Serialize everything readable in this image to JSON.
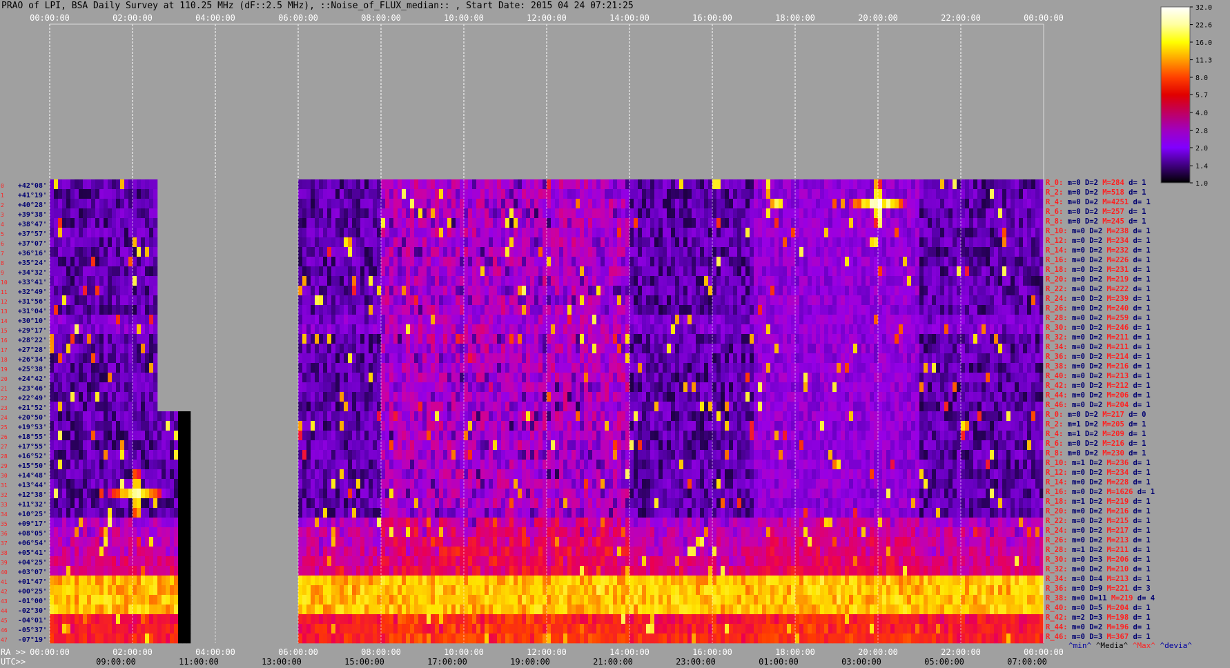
{
  "title": "PRAO of LPI, BSA Daily Survey at 110.25 MHz (dF::2.5 MHz), ::Noise_of_FLUX_median:: , Start Date: 2015 04 24 07:21:25",
  "chart_data": {
    "type": "heatmap",
    "top_axis_ticks": [
      "00:00:00",
      "02:00:00",
      "04:00:00",
      "06:00:00",
      "08:00:00",
      "10:00:00",
      "12:00:00",
      "14:00:00",
      "16:00:00",
      "18:00:00",
      "20:00:00",
      "22:00:00",
      "00:00:00"
    ],
    "bottom_ra_label": "RA >>",
    "bottom_ra_ticks": [
      "00:00:00",
      "02:00:00",
      "04:00:00",
      "06:00:00",
      "08:00:00",
      "10:00:00",
      "12:00:00",
      "14:00:00",
      "16:00:00",
      "18:00:00",
      "20:00:00",
      "22:00:00",
      "00:00:00"
    ],
    "bottom_utc_label": "UTC>>",
    "bottom_utc_ticks": [
      "09:00:00",
      "11:00:00",
      "13:00:00",
      "15:00:00",
      "17:00:00",
      "19:00:00",
      "21:00:00",
      "23:00:00",
      "01:00:00",
      "03:00:00",
      "05:00:00",
      "07:00:00"
    ],
    "declinations": [
      "+42°08'",
      "+41°19'",
      "+40°28'",
      "+39°38'",
      "+38°47'",
      "+37°57'",
      "+37°07'",
      "+36°16'",
      "+35°24'",
      "+34°32'",
      "+33°41'",
      "+32°49'",
      "+31°56'",
      "+31°04'",
      "+30°10'",
      "+29°17'",
      "+28°22'",
      "+27°28'",
      "+26°34'",
      "+25°38'",
      "+24°42'",
      "+23°46'",
      "+22°49'",
      "+21°52'",
      "+20°50'",
      "+19°53'",
      "+18°55'",
      "+17°55'",
      "+16°52'",
      "+15°50'",
      "+14°48'",
      "+13°44'",
      "+12°38'",
      "+11°32'",
      "+10°25'",
      "+09°17'",
      "+08°05'",
      "+06°54'",
      "+05°41'",
      "+04°25'",
      "+03°07'",
      "+01°47'",
      "+00°25'",
      "-01°00'",
      "-02°30'",
      "-04°01'",
      "-05°37'",
      "-07°19'"
    ],
    "colorbar_ticks": [
      "32.0",
      "22.6",
      "16.0",
      "11.3",
      "8.0",
      "5.7",
      "4.0",
      "2.8",
      "2.0",
      "1.4",
      "1.0"
    ],
    "colorbar_colors": [
      "#ffffff",
      "#ffffa0",
      "#ffff00",
      "#ffa000",
      "#ff4000",
      "#e00000",
      "#c00060",
      "#a000c0",
      "#8000ff",
      "#400080",
      "#000000"
    ],
    "colorbar_scale": "log",
    "colorbar_range": [
      1.0,
      32.0
    ],
    "background_color": "#a0a0a0",
    "ra_range_hours": [
      0,
      24
    ],
    "data_gaps_ra_hours": [
      {
        "from": 2.6,
        "to": 6.0,
        "dec_from": "+42°08'",
        "dec_to": "+21°52'"
      },
      {
        "from": 3.1,
        "to": 6.0,
        "dec_from": "+20°50'",
        "dec_to": "-07°19'"
      }
    ],
    "features": [
      {
        "kind": "point_source",
        "ra_hours": 20.0,
        "dec": "+40°28'",
        "brightness": 32.0
      },
      {
        "kind": "point_source",
        "ra_hours": 2.1,
        "dec": "+12°38'",
        "brightness": 22.6
      },
      {
        "kind": "bright_band",
        "dec_from": "+01°47'",
        "dec_to": "-02°30'",
        "brightness": 16.0
      },
      {
        "kind": "bright_band",
        "dec_from": "+30°10'",
        "dec_to": "+29°17'",
        "brightness": 2.8
      }
    ]
  },
  "stats": {
    "rows": [
      {
        "label": "R_0:",
        "m": "m=0",
        "D": "D=2",
        "M": "M=284",
        "d": "d= 1"
      },
      {
        "label": "R_2:",
        "m": "m=0",
        "D": "D=2",
        "M": "M=518",
        "d": "d= 1"
      },
      {
        "label": "R_4:",
        "m": "m=0",
        "D": "D=2",
        "M": "M=4251",
        "d": "d= 1"
      },
      {
        "label": "R_6:",
        "m": "m=0",
        "D": "D=2",
        "M": "M=257",
        "d": "d= 1"
      },
      {
        "label": "R_8:",
        "m": "m=0",
        "D": "D=2",
        "M": "M=245",
        "d": "d= 1"
      },
      {
        "label": "R_10:",
        "m": "m=0",
        "D": "D=2",
        "M": "M=238",
        "d": "d= 1"
      },
      {
        "label": "R_12:",
        "m": "m=0",
        "D": "D=2",
        "M": "M=234",
        "d": "d= 1"
      },
      {
        "label": "R_14:",
        "m": "m=0",
        "D": "D=2",
        "M": "M=232",
        "d": "d= 1"
      },
      {
        "label": "R_16:",
        "m": "m=0",
        "D": "D=2",
        "M": "M=226",
        "d": "d= 1"
      },
      {
        "label": "R_18:",
        "m": "m=0",
        "D": "D=2",
        "M": "M=231",
        "d": "d= 1"
      },
      {
        "label": "R_20:",
        "m": "m=0",
        "D": "D=2",
        "M": "M=219",
        "d": "d= 1"
      },
      {
        "label": "R_22:",
        "m": "m=0",
        "D": "D=2",
        "M": "M=222",
        "d": "d= 1"
      },
      {
        "label": "R_24:",
        "m": "m=0",
        "D": "D=2",
        "M": "M=239",
        "d": "d= 1"
      },
      {
        "label": "R_26:",
        "m": "m=0",
        "D": "D=2",
        "M": "M=240",
        "d": "d= 1"
      },
      {
        "label": "R_28:",
        "m": "m=0",
        "D": "D=2",
        "M": "M=259",
        "d": "d= 1"
      },
      {
        "label": "R_30:",
        "m": "m=0",
        "D": "D=2",
        "M": "M=246",
        "d": "d= 1"
      },
      {
        "label": "R_32:",
        "m": "m=0",
        "D": "D=2",
        "M": "M=211",
        "d": "d= 1"
      },
      {
        "label": "R_34:",
        "m": "m=0",
        "D": "D=2",
        "M": "M=211",
        "d": "d= 1"
      },
      {
        "label": "R_36:",
        "m": "m=0",
        "D": "D=2",
        "M": "M=214",
        "d": "d= 1"
      },
      {
        "label": "R_38:",
        "m": "m=0",
        "D": "D=2",
        "M": "M=216",
        "d": "d= 1"
      },
      {
        "label": "R_40:",
        "m": "m=0",
        "D": "D=2",
        "M": "M=213",
        "d": "d= 1"
      },
      {
        "label": "R_42:",
        "m": "m=0",
        "D": "D=2",
        "M": "M=212",
        "d": "d= 1"
      },
      {
        "label": "R_44:",
        "m": "m=0",
        "D": "D=2",
        "M": "M=206",
        "d": "d= 1"
      },
      {
        "label": "R_46:",
        "m": "m=0",
        "D": "D=2",
        "M": "M=204",
        "d": "d= 1"
      },
      {
        "label": "R_0:",
        "m": "m=0",
        "D": "D=2",
        "M": "M=217",
        "d": "d= 0"
      },
      {
        "label": "R_2:",
        "m": "m=1",
        "D": "D=2",
        "M": "M=205",
        "d": "d= 1"
      },
      {
        "label": "R_4:",
        "m": "m=1",
        "D": "D=2",
        "M": "M=209",
        "d": "d= 1"
      },
      {
        "label": "R_6:",
        "m": "m=0",
        "D": "D=2",
        "M": "M=216",
        "d": "d= 1"
      },
      {
        "label": "R_8:",
        "m": "m=0",
        "D": "D=2",
        "M": "M=230",
        "d": "d= 1"
      },
      {
        "label": "R_10:",
        "m": "m=1",
        "D": "D=2",
        "M": "M=236",
        "d": "d= 1"
      },
      {
        "label": "R_12:",
        "m": "m=0",
        "D": "D=2",
        "M": "M=234",
        "d": "d= 1"
      },
      {
        "label": "R_14:",
        "m": "m=0",
        "D": "D=2",
        "M": "M=228",
        "d": "d= 1"
      },
      {
        "label": "R_16:",
        "m": "m=0",
        "D": "D=2",
        "M": "M=1626",
        "d": "d= 1"
      },
      {
        "label": "R_18:",
        "m": "m=1",
        "D": "D=2",
        "M": "M=219",
        "d": "d= 1"
      },
      {
        "label": "R_20:",
        "m": "m=0",
        "D": "D=2",
        "M": "M=216",
        "d": "d= 1"
      },
      {
        "label": "R_22:",
        "m": "m=0",
        "D": "D=2",
        "M": "M=215",
        "d": "d= 1"
      },
      {
        "label": "R_24:",
        "m": "m=0",
        "D": "D=2",
        "M": "M=217",
        "d": "d= 1"
      },
      {
        "label": "R_26:",
        "m": "m=0",
        "D": "D=2",
        "M": "M=213",
        "d": "d= 1"
      },
      {
        "label": "R_28:",
        "m": "m=1",
        "D": "D=2",
        "M": "M=211",
        "d": "d= 1"
      },
      {
        "label": "R_30:",
        "m": "m=0",
        "D": "D=3",
        "M": "M=206",
        "d": "d= 1"
      },
      {
        "label": "R_32:",
        "m": "m=0",
        "D": "D=2",
        "M": "M=210",
        "d": "d= 1"
      },
      {
        "label": "R_34:",
        "m": "m=0",
        "D": "D=4",
        "M": "M=213",
        "d": "d= 1"
      },
      {
        "label": "R_36:",
        "m": "m=0",
        "D": "D=9",
        "M": "M=221",
        "d": "d= 3"
      },
      {
        "label": "R_38:",
        "m": "m=0",
        "D": "D=11",
        "M": "M=219",
        "d": "d= 4"
      },
      {
        "label": "R_40:",
        "m": "m=0",
        "D": "D=5",
        "M": "M=204",
        "d": "d= 1"
      },
      {
        "label": "R_42:",
        "m": "m=2",
        "D": "D=3",
        "M": "M=198",
        "d": "d= 1"
      },
      {
        "label": "R_44:",
        "m": "m=0",
        "D": "D=2",
        "M": "M=196",
        "d": "d= 1"
      },
      {
        "label": "R_46:",
        "m": "m=0",
        "D": "D=3",
        "M": "M=367",
        "d": "d= 1"
      }
    ],
    "footer": {
      "min": "^min^",
      "median": "^Media^",
      "max": "^Max^",
      "dev": "^devia^"
    }
  }
}
